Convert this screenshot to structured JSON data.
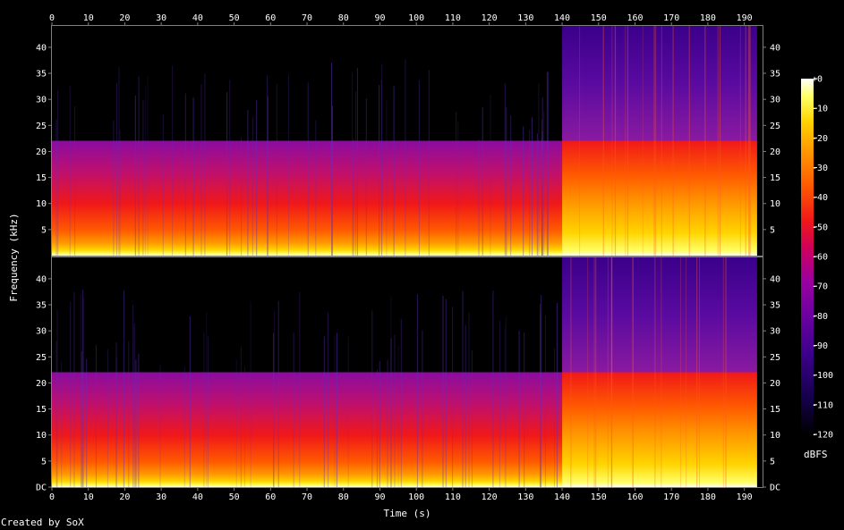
{
  "chart_data": {
    "type": "heatmap",
    "xlabel": "Time (s)",
    "ylabel": "Frequency (kHz)",
    "colorbar_label": "dBFS",
    "x_ticks": [
      0,
      10,
      20,
      30,
      40,
      50,
      60,
      70,
      80,
      90,
      100,
      110,
      120,
      130,
      140,
      150,
      160,
      170,
      180,
      190
    ],
    "xlim": [
      0,
      195
    ],
    "y_ticks": [
      {
        "value": 0,
        "label": "DC"
      },
      {
        "value": 5,
        "label": "5"
      },
      {
        "value": 10,
        "label": "10"
      },
      {
        "value": 15,
        "label": "15"
      },
      {
        "value": 20,
        "label": "20"
      },
      {
        "value": 25,
        "label": "25"
      },
      {
        "value": 30,
        "label": "30"
      },
      {
        "value": 35,
        "label": "35"
      },
      {
        "value": 40,
        "label": "40"
      }
    ],
    "ylim": [
      0,
      44.1
    ],
    "colorbar_ticks": [
      "+0",
      "-10",
      "-20",
      "-30",
      "-40",
      "-50",
      "-60",
      "-70",
      "-80",
      "-90",
      "-100",
      "-110",
      "-120"
    ],
    "color_range_dbfs": [
      -120,
      0
    ],
    "channels": 2,
    "segments": [
      {
        "start_s": 0,
        "end_s": 140,
        "upper_frequency_khz": 22.05
      },
      {
        "start_s": 140,
        "end_s": 195,
        "upper_frequency_khz": 44.1
      }
    ],
    "colors": {
      "background": "#000000",
      "frame": "#7f7f7f",
      "text": "#ffffff",
      "palette": [
        "#000000",
        "#14004a",
        "#3a0088",
        "#6a00a0",
        "#9a00a0",
        "#cc0060",
        "#f01818",
        "#ff5a00",
        "#ff9a00",
        "#ffd400",
        "#ffff66",
        "#ffffff"
      ]
    }
  },
  "footer": {
    "credit": "Created by SoX"
  }
}
